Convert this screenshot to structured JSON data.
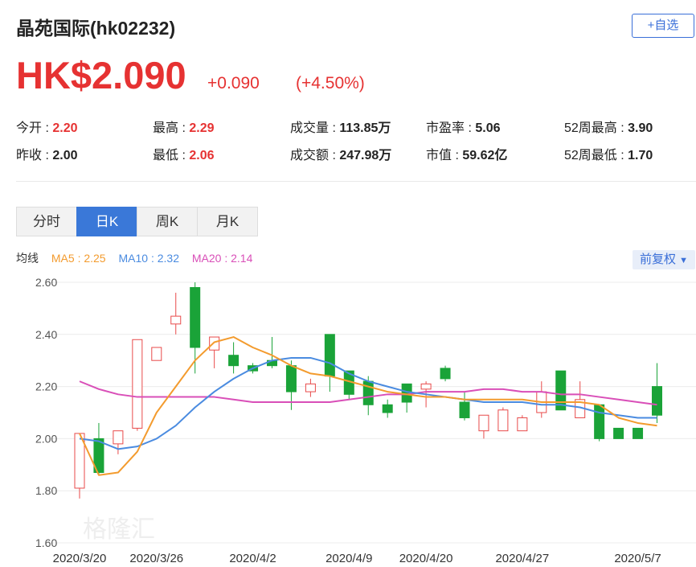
{
  "header": {
    "title": "晶苑国际(hk02232)",
    "watch_label": "+自选",
    "price": "HK$2.090",
    "change": "+0.090",
    "change_pct": "(+4.50%)"
  },
  "stats": [
    {
      "label": "今开 : ",
      "value": "2.20",
      "tone": "red"
    },
    {
      "label": "最高 : ",
      "value": "2.29",
      "tone": "red"
    },
    {
      "label": "成交量 : ",
      "value": "113.85万",
      "tone": "dark"
    },
    {
      "label": "市盈率 : ",
      "value": "5.06",
      "tone": "dark"
    },
    {
      "label": "52周最高 : ",
      "value": "3.90",
      "tone": "dark"
    },
    {
      "label": "昨收 : ",
      "value": "2.00",
      "tone": "dark"
    },
    {
      "label": "最低 : ",
      "value": "2.06",
      "tone": "red"
    },
    {
      "label": "成交额 : ",
      "value": "247.98万",
      "tone": "dark"
    },
    {
      "label": "市值 : ",
      "value": "59.62亿",
      "tone": "dark"
    },
    {
      "label": "52周最低 : ",
      "value": "1.70",
      "tone": "dark"
    }
  ],
  "tabs": [
    "分时",
    "日K",
    "周K",
    "月K"
  ],
  "active_tab": 1,
  "indicators": {
    "label": "均线",
    "ma5": "MA5 : 2.25",
    "ma10": "MA10 : 2.32",
    "ma20": "MA20 : 2.14"
  },
  "adjust_label": "前复权",
  "colors": {
    "up": "#e84a4a",
    "down": "#1aa338",
    "ma5": "#f39b2e",
    "ma10": "#4a8be0",
    "ma20": "#d94fb8",
    "accent": "#3a78d8",
    "price": "#e63232"
  },
  "chart_data": {
    "type": "candlestick",
    "y_ticks": [
      "2.60",
      "2.40",
      "2.20",
      "2.00",
      "1.80",
      "1.60"
    ],
    "ylim": [
      1.6,
      2.6
    ],
    "x_tick_labels": [
      {
        "label": "2020/3/20",
        "index": 0
      },
      {
        "label": "2020/3/26",
        "index": 4
      },
      {
        "label": "2020/4/2",
        "index": 9
      },
      {
        "label": "2020/4/9",
        "index": 14
      },
      {
        "label": "2020/4/20",
        "index": 18
      },
      {
        "label": "2020/4/27",
        "index": 23
      },
      {
        "label": "2020/5/7",
        "index": 29
      }
    ],
    "candles": [
      {
        "o": 1.81,
        "h": 2.02,
        "l": 1.77,
        "c": 2.02
      },
      {
        "o": 2.0,
        "h": 2.06,
        "l": 1.86,
        "c": 1.87
      },
      {
        "o": 1.98,
        "h": 2.03,
        "l": 1.94,
        "c": 2.03
      },
      {
        "o": 2.04,
        "h": 2.38,
        "l": 2.03,
        "c": 2.38
      },
      {
        "o": 2.3,
        "h": 2.35,
        "l": 2.3,
        "c": 2.35
      },
      {
        "o": 2.44,
        "h": 2.56,
        "l": 2.4,
        "c": 2.47
      },
      {
        "o": 2.58,
        "h": 2.6,
        "l": 2.25,
        "c": 2.35
      },
      {
        "o": 2.34,
        "h": 2.39,
        "l": 2.27,
        "c": 2.39
      },
      {
        "o": 2.32,
        "h": 2.37,
        "l": 2.25,
        "c": 2.28
      },
      {
        "o": 2.28,
        "h": 2.29,
        "l": 2.25,
        "c": 2.26
      },
      {
        "o": 2.3,
        "h": 2.39,
        "l": 2.27,
        "c": 2.28
      },
      {
        "o": 2.28,
        "h": 2.3,
        "l": 2.11,
        "c": 2.18
      },
      {
        "o": 2.18,
        "h": 2.23,
        "l": 2.16,
        "c": 2.21
      },
      {
        "o": 2.4,
        "h": 2.4,
        "l": 2.18,
        "c": 2.24
      },
      {
        "o": 2.26,
        "h": 2.26,
        "l": 2.15,
        "c": 2.17
      },
      {
        "o": 2.22,
        "h": 2.24,
        "l": 2.09,
        "c": 2.13
      },
      {
        "o": 2.13,
        "h": 2.15,
        "l": 2.08,
        "c": 2.1
      },
      {
        "o": 2.21,
        "h": 2.21,
        "l": 2.1,
        "c": 2.14
      },
      {
        "o": 2.19,
        "h": 2.22,
        "l": 2.12,
        "c": 2.21
      },
      {
        "o": 2.27,
        "h": 2.28,
        "l": 2.22,
        "c": 2.23
      },
      {
        "o": 2.14,
        "h": 2.18,
        "l": 2.07,
        "c": 2.08
      },
      {
        "o": 2.03,
        "h": 2.09,
        "l": 2.0,
        "c": 2.09
      },
      {
        "o": 2.03,
        "h": 2.12,
        "l": 2.03,
        "c": 2.11
      },
      {
        "o": 2.03,
        "h": 2.09,
        "l": 2.03,
        "c": 2.08
      },
      {
        "o": 2.1,
        "h": 2.22,
        "l": 2.08,
        "c": 2.18
      },
      {
        "o": 2.26,
        "h": 2.26,
        "l": 2.11,
        "c": 2.11
      },
      {
        "o": 2.08,
        "h": 2.22,
        "l": 2.08,
        "c": 2.15
      },
      {
        "o": 2.13,
        "h": 2.13,
        "l": 1.99,
        "c": 2.0
      },
      {
        "o": 2.04,
        "h": 2.04,
        "l": 2.0,
        "c": 2.0
      },
      {
        "o": 2.04,
        "h": 2.04,
        "l": 2.0,
        "c": 2.0
      },
      {
        "o": 2.2,
        "h": 2.29,
        "l": 2.06,
        "c": 2.09
      }
    ],
    "ma5": [
      2.02,
      1.86,
      1.87,
      1.95,
      2.1,
      2.2,
      2.3,
      2.37,
      2.39,
      2.35,
      2.32,
      2.28,
      2.25,
      2.24,
      2.22,
      2.2,
      2.18,
      2.17,
      2.16,
      2.16,
      2.15,
      2.15,
      2.15,
      2.15,
      2.14,
      2.14,
      2.14,
      2.13,
      2.08,
      2.06,
      2.05
    ],
    "ma10": [
      2.0,
      1.99,
      1.96,
      1.97,
      2.0,
      2.05,
      2.12,
      2.18,
      2.23,
      2.27,
      2.3,
      2.31,
      2.31,
      2.29,
      2.25,
      2.22,
      2.2,
      2.18,
      2.17,
      2.16,
      2.15,
      2.14,
      2.14,
      2.14,
      2.13,
      2.13,
      2.12,
      2.1,
      2.09,
      2.08,
      2.08
    ],
    "ma20": [
      2.22,
      2.19,
      2.17,
      2.16,
      2.16,
      2.16,
      2.16,
      2.16,
      2.15,
      2.14,
      2.14,
      2.14,
      2.14,
      2.14,
      2.15,
      2.16,
      2.17,
      2.17,
      2.18,
      2.18,
      2.18,
      2.19,
      2.19,
      2.18,
      2.18,
      2.17,
      2.17,
      2.16,
      2.15,
      2.14,
      2.13
    ]
  }
}
